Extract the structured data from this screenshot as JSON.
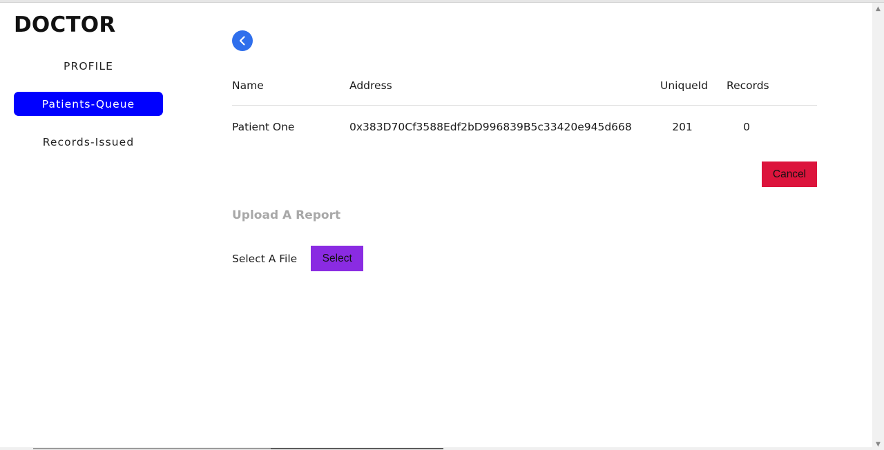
{
  "sidebar": {
    "brand": "DOCTOR",
    "items": [
      {
        "label": "PROFILE",
        "active": false
      },
      {
        "label": "Patients-Queue",
        "active": true
      },
      {
        "label": "Records-Issued",
        "active": false
      }
    ]
  },
  "main": {
    "back_icon": "chevron-left-icon",
    "table": {
      "headers": [
        "Name",
        "Address",
        "UniqueId",
        "Records"
      ],
      "rows": [
        {
          "name": "Patient One",
          "address": "0x383D70Cf3588Edf2bD996839B5c33420e945d668",
          "unique_id": "201",
          "records": "0"
        }
      ]
    },
    "cancel_label": "Cancel",
    "upload": {
      "title": "Upload A Report",
      "file_label": "Select A File",
      "select_label": "Select"
    }
  },
  "colors": {
    "active_nav": "#0000ff",
    "back_button": "#2f6fec",
    "cancel": "#dc143c",
    "select": "#8a2be2",
    "section_title": "#a8a8a8"
  }
}
